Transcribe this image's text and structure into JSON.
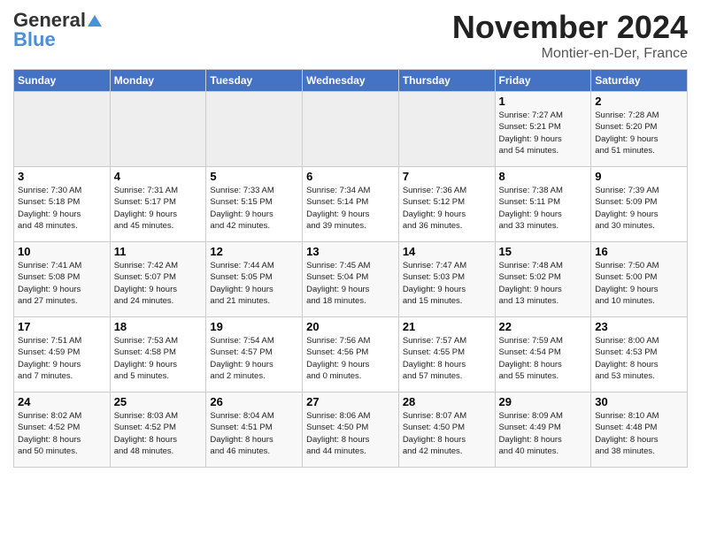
{
  "header": {
    "logo_general": "General",
    "logo_blue": "Blue",
    "month_title": "November 2024",
    "location": "Montier-en-Der, France"
  },
  "days_of_week": [
    "Sunday",
    "Monday",
    "Tuesday",
    "Wednesday",
    "Thursday",
    "Friday",
    "Saturday"
  ],
  "weeks": [
    [
      {
        "day": "",
        "info": ""
      },
      {
        "day": "",
        "info": ""
      },
      {
        "day": "",
        "info": ""
      },
      {
        "day": "",
        "info": ""
      },
      {
        "day": "",
        "info": ""
      },
      {
        "day": "1",
        "info": "Sunrise: 7:27 AM\nSunset: 5:21 PM\nDaylight: 9 hours\nand 54 minutes."
      },
      {
        "day": "2",
        "info": "Sunrise: 7:28 AM\nSunset: 5:20 PM\nDaylight: 9 hours\nand 51 minutes."
      }
    ],
    [
      {
        "day": "3",
        "info": "Sunrise: 7:30 AM\nSunset: 5:18 PM\nDaylight: 9 hours\nand 48 minutes."
      },
      {
        "day": "4",
        "info": "Sunrise: 7:31 AM\nSunset: 5:17 PM\nDaylight: 9 hours\nand 45 minutes."
      },
      {
        "day": "5",
        "info": "Sunrise: 7:33 AM\nSunset: 5:15 PM\nDaylight: 9 hours\nand 42 minutes."
      },
      {
        "day": "6",
        "info": "Sunrise: 7:34 AM\nSunset: 5:14 PM\nDaylight: 9 hours\nand 39 minutes."
      },
      {
        "day": "7",
        "info": "Sunrise: 7:36 AM\nSunset: 5:12 PM\nDaylight: 9 hours\nand 36 minutes."
      },
      {
        "day": "8",
        "info": "Sunrise: 7:38 AM\nSunset: 5:11 PM\nDaylight: 9 hours\nand 33 minutes."
      },
      {
        "day": "9",
        "info": "Sunrise: 7:39 AM\nSunset: 5:09 PM\nDaylight: 9 hours\nand 30 minutes."
      }
    ],
    [
      {
        "day": "10",
        "info": "Sunrise: 7:41 AM\nSunset: 5:08 PM\nDaylight: 9 hours\nand 27 minutes."
      },
      {
        "day": "11",
        "info": "Sunrise: 7:42 AM\nSunset: 5:07 PM\nDaylight: 9 hours\nand 24 minutes."
      },
      {
        "day": "12",
        "info": "Sunrise: 7:44 AM\nSunset: 5:05 PM\nDaylight: 9 hours\nand 21 minutes."
      },
      {
        "day": "13",
        "info": "Sunrise: 7:45 AM\nSunset: 5:04 PM\nDaylight: 9 hours\nand 18 minutes."
      },
      {
        "day": "14",
        "info": "Sunrise: 7:47 AM\nSunset: 5:03 PM\nDaylight: 9 hours\nand 15 minutes."
      },
      {
        "day": "15",
        "info": "Sunrise: 7:48 AM\nSunset: 5:02 PM\nDaylight: 9 hours\nand 13 minutes."
      },
      {
        "day": "16",
        "info": "Sunrise: 7:50 AM\nSunset: 5:00 PM\nDaylight: 9 hours\nand 10 minutes."
      }
    ],
    [
      {
        "day": "17",
        "info": "Sunrise: 7:51 AM\nSunset: 4:59 PM\nDaylight: 9 hours\nand 7 minutes."
      },
      {
        "day": "18",
        "info": "Sunrise: 7:53 AM\nSunset: 4:58 PM\nDaylight: 9 hours\nand 5 minutes."
      },
      {
        "day": "19",
        "info": "Sunrise: 7:54 AM\nSunset: 4:57 PM\nDaylight: 9 hours\nand 2 minutes."
      },
      {
        "day": "20",
        "info": "Sunrise: 7:56 AM\nSunset: 4:56 PM\nDaylight: 9 hours\nand 0 minutes."
      },
      {
        "day": "21",
        "info": "Sunrise: 7:57 AM\nSunset: 4:55 PM\nDaylight: 8 hours\nand 57 minutes."
      },
      {
        "day": "22",
        "info": "Sunrise: 7:59 AM\nSunset: 4:54 PM\nDaylight: 8 hours\nand 55 minutes."
      },
      {
        "day": "23",
        "info": "Sunrise: 8:00 AM\nSunset: 4:53 PM\nDaylight: 8 hours\nand 53 minutes."
      }
    ],
    [
      {
        "day": "24",
        "info": "Sunrise: 8:02 AM\nSunset: 4:52 PM\nDaylight: 8 hours\nand 50 minutes."
      },
      {
        "day": "25",
        "info": "Sunrise: 8:03 AM\nSunset: 4:52 PM\nDaylight: 8 hours\nand 48 minutes."
      },
      {
        "day": "26",
        "info": "Sunrise: 8:04 AM\nSunset: 4:51 PM\nDaylight: 8 hours\nand 46 minutes."
      },
      {
        "day": "27",
        "info": "Sunrise: 8:06 AM\nSunset: 4:50 PM\nDaylight: 8 hours\nand 44 minutes."
      },
      {
        "day": "28",
        "info": "Sunrise: 8:07 AM\nSunset: 4:50 PM\nDaylight: 8 hours\nand 42 minutes."
      },
      {
        "day": "29",
        "info": "Sunrise: 8:09 AM\nSunset: 4:49 PM\nDaylight: 8 hours\nand 40 minutes."
      },
      {
        "day": "30",
        "info": "Sunrise: 8:10 AM\nSunset: 4:48 PM\nDaylight: 8 hours\nand 38 minutes."
      }
    ]
  ]
}
